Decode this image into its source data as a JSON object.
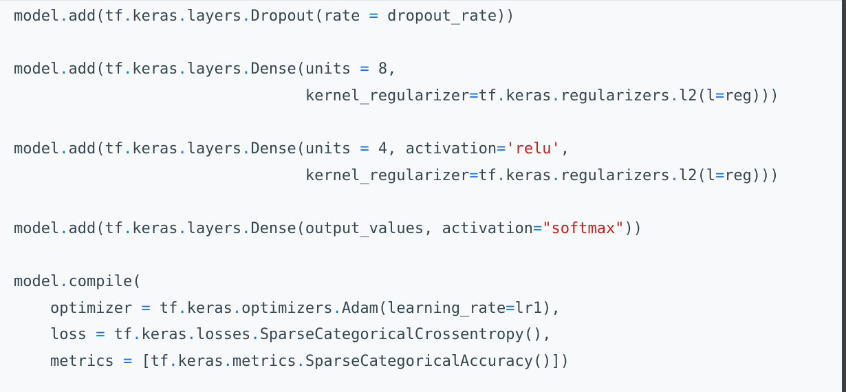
{
  "colors": {
    "background": "#f8f9fa",
    "text": "#37474f",
    "operator": "#1a73e8",
    "string": "#c5221f",
    "edge": "#3c4043"
  },
  "code": {
    "language": "python",
    "lines": [
      [
        {
          "t": "model",
          "k": "plain"
        },
        {
          "t": ".",
          "k": "op"
        },
        {
          "t": "add(tf",
          "k": "plain"
        },
        {
          "t": ".",
          "k": "op"
        },
        {
          "t": "keras",
          "k": "plain"
        },
        {
          "t": ".",
          "k": "op"
        },
        {
          "t": "layers",
          "k": "plain"
        },
        {
          "t": ".",
          "k": "op"
        },
        {
          "t": "Dropout(rate ",
          "k": "plain"
        },
        {
          "t": "=",
          "k": "op"
        },
        {
          "t": " dropout_rate))",
          "k": "plain"
        }
      ],
      [],
      [
        {
          "t": "model",
          "k": "plain"
        },
        {
          "t": ".",
          "k": "op"
        },
        {
          "t": "add(tf",
          "k": "plain"
        },
        {
          "t": ".",
          "k": "op"
        },
        {
          "t": "keras",
          "k": "plain"
        },
        {
          "t": ".",
          "k": "op"
        },
        {
          "t": "layers",
          "k": "plain"
        },
        {
          "t": ".",
          "k": "op"
        },
        {
          "t": "Dense(units ",
          "k": "plain"
        },
        {
          "t": "=",
          "k": "op"
        },
        {
          "t": " 8,",
          "k": "plain"
        }
      ],
      [
        {
          "t": "                                kernel_regularizer",
          "k": "plain"
        },
        {
          "t": "=",
          "k": "op"
        },
        {
          "t": "tf",
          "k": "plain"
        },
        {
          "t": ".",
          "k": "op"
        },
        {
          "t": "keras",
          "k": "plain"
        },
        {
          "t": ".",
          "k": "op"
        },
        {
          "t": "regularizers",
          "k": "plain"
        },
        {
          "t": ".",
          "k": "op"
        },
        {
          "t": "l2(l",
          "k": "plain"
        },
        {
          "t": "=",
          "k": "op"
        },
        {
          "t": "reg)))",
          "k": "plain"
        }
      ],
      [],
      [
        {
          "t": "model",
          "k": "plain"
        },
        {
          "t": ".",
          "k": "op"
        },
        {
          "t": "add(tf",
          "k": "plain"
        },
        {
          "t": ".",
          "k": "op"
        },
        {
          "t": "keras",
          "k": "plain"
        },
        {
          "t": ".",
          "k": "op"
        },
        {
          "t": "layers",
          "k": "plain"
        },
        {
          "t": ".",
          "k": "op"
        },
        {
          "t": "Dense(units ",
          "k": "plain"
        },
        {
          "t": "=",
          "k": "op"
        },
        {
          "t": " 4, activation",
          "k": "plain"
        },
        {
          "t": "=",
          "k": "op"
        },
        {
          "t": "'relu'",
          "k": "str"
        },
        {
          "t": ",",
          "k": "plain"
        }
      ],
      [
        {
          "t": "                                kernel_regularizer",
          "k": "plain"
        },
        {
          "t": "=",
          "k": "op"
        },
        {
          "t": "tf",
          "k": "plain"
        },
        {
          "t": ".",
          "k": "op"
        },
        {
          "t": "keras",
          "k": "plain"
        },
        {
          "t": ".",
          "k": "op"
        },
        {
          "t": "regularizers",
          "k": "plain"
        },
        {
          "t": ".",
          "k": "op"
        },
        {
          "t": "l2(l",
          "k": "plain"
        },
        {
          "t": "=",
          "k": "op"
        },
        {
          "t": "reg)))",
          "k": "plain"
        }
      ],
      [],
      [
        {
          "t": "model",
          "k": "plain"
        },
        {
          "t": ".",
          "k": "op"
        },
        {
          "t": "add(tf",
          "k": "plain"
        },
        {
          "t": ".",
          "k": "op"
        },
        {
          "t": "keras",
          "k": "plain"
        },
        {
          "t": ".",
          "k": "op"
        },
        {
          "t": "layers",
          "k": "plain"
        },
        {
          "t": ".",
          "k": "op"
        },
        {
          "t": "Dense(output_values, activation",
          "k": "plain"
        },
        {
          "t": "=",
          "k": "op"
        },
        {
          "t": "\"softmax\"",
          "k": "str"
        },
        {
          "t": "))",
          "k": "plain"
        }
      ],
      [],
      [
        {
          "t": "model",
          "k": "plain"
        },
        {
          "t": ".",
          "k": "op"
        },
        {
          "t": "compile(",
          "k": "plain"
        }
      ],
      [
        {
          "t": "    optimizer ",
          "k": "plain"
        },
        {
          "t": "=",
          "k": "op"
        },
        {
          "t": " tf",
          "k": "plain"
        },
        {
          "t": ".",
          "k": "op"
        },
        {
          "t": "keras",
          "k": "plain"
        },
        {
          "t": ".",
          "k": "op"
        },
        {
          "t": "optimizers",
          "k": "plain"
        },
        {
          "t": ".",
          "k": "op"
        },
        {
          "t": "Adam(learning_rate",
          "k": "plain"
        },
        {
          "t": "=",
          "k": "op"
        },
        {
          "t": "lr1),",
          "k": "plain"
        }
      ],
      [
        {
          "t": "    loss ",
          "k": "plain"
        },
        {
          "t": "=",
          "k": "op"
        },
        {
          "t": " tf",
          "k": "plain"
        },
        {
          "t": ".",
          "k": "op"
        },
        {
          "t": "keras",
          "k": "plain"
        },
        {
          "t": ".",
          "k": "op"
        },
        {
          "t": "losses",
          "k": "plain"
        },
        {
          "t": ".",
          "k": "op"
        },
        {
          "t": "SparseCategoricalCrossentropy(),",
          "k": "plain"
        }
      ],
      [
        {
          "t": "    metrics ",
          "k": "plain"
        },
        {
          "t": "=",
          "k": "op"
        },
        {
          "t": " [tf",
          "k": "plain"
        },
        {
          "t": ".",
          "k": "op"
        },
        {
          "t": "keras",
          "k": "plain"
        },
        {
          "t": ".",
          "k": "op"
        },
        {
          "t": "metrics",
          "k": "plain"
        },
        {
          "t": ".",
          "k": "op"
        },
        {
          "t": "SparseCategoricalAccuracy()])",
          "k": "plain"
        }
      ]
    ]
  }
}
